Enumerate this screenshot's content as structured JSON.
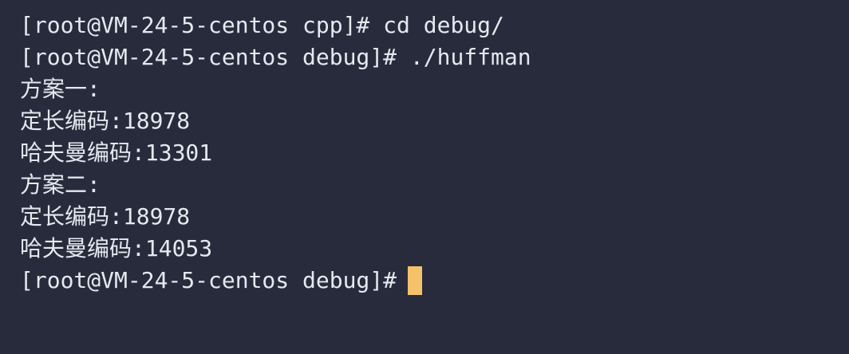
{
  "terminal": {
    "background": "#282b3c",
    "foreground": "#e6e8ef",
    "cursor_color": "#f5c16a",
    "lines": [
      "[root@VM-24-5-centos cpp]# cd debug/",
      "[root@VM-24-5-centos debug]# ./huffman",
      "方案一:",
      "定长编码:18978",
      "哈夫曼编码:13301",
      "方案二:",
      "定长编码:18978",
      "哈夫曼编码:14053"
    ],
    "prompt": "[root@VM-24-5-centos debug]#"
  }
}
